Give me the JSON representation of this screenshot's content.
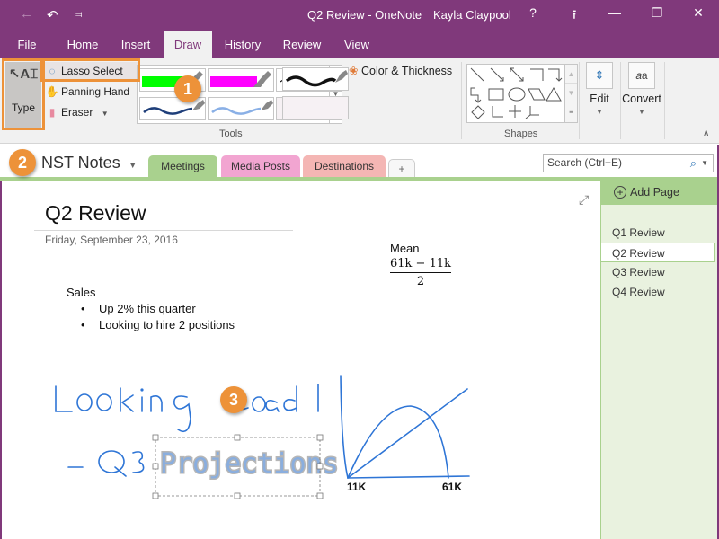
{
  "window": {
    "title": "Q2 Review - OneNote",
    "user": "Kayla Claypool",
    "help": "?",
    "icons": [
      "back-icon",
      "undo-icon",
      "customize-qat-icon",
      "ribbon-display-icon",
      "minimize-icon",
      "restore-icon",
      "close-icon"
    ]
  },
  "ribbon_tabs": [
    "File",
    "Home",
    "Insert",
    "Draw",
    "History",
    "Review",
    "View"
  ],
  "active_tab": "Draw",
  "ribbon": {
    "type_label": "Type",
    "lasso_label": "Lasso Select",
    "panning_label": "Panning Hand",
    "eraser_label": "Eraser",
    "tools_group": "Tools",
    "color_thickness_label": "Color & Thickness",
    "shapes_group": "Shapes",
    "edit_label": "Edit",
    "convert_label": "Convert",
    "pens": [
      {
        "kind": "highlighter",
        "color": "#00ff00"
      },
      {
        "kind": "highlighter",
        "color": "#ff00ff"
      },
      {
        "kind": "pen-thin",
        "color": "#000000"
      },
      {
        "kind": "pen-thick",
        "color": "#000000"
      },
      {
        "kind": "pen",
        "color": "#1f3f7a"
      },
      {
        "kind": "pen",
        "color": "#8ab0e6"
      },
      {
        "kind": "empty"
      },
      {
        "kind": "empty"
      }
    ]
  },
  "notebook": {
    "name": "NST Notes",
    "sections": [
      {
        "label": "Meetings",
        "color": "#a9d18e"
      },
      {
        "label": "Media Posts",
        "color": "#f2a5d1"
      },
      {
        "label": "Destinations",
        "color": "#f4b6b4"
      }
    ],
    "add_section": "+",
    "search_placeholder": "Search (Ctrl+E)"
  },
  "page": {
    "title": "Q2 Review",
    "date": "Friday, September 23, 2016",
    "sales_heading": "Sales",
    "bullets": [
      "Up 2% this quarter",
      "Looking to hire 2 positions"
    ],
    "mean_label": "Mean",
    "formula_num": "61k − 11k",
    "formula_den": "2",
    "ink_text_1": "Looking ahead",
    "ink_text_2": "- Q3",
    "ink_selected": "Projections",
    "graph_labels": [
      "11K",
      "61K"
    ]
  },
  "pages_panel": {
    "add_page": "Add Page",
    "pages": [
      "Q1 Review",
      "Q2 Review",
      "Q3 Review",
      "Q4 Review"
    ],
    "selected": "Q2 Review"
  },
  "callouts": [
    "1",
    "2",
    "3"
  ],
  "colors": {
    "brand": "#80397b",
    "callout": "#ed9239",
    "ink_blue": "#2e75d6"
  }
}
